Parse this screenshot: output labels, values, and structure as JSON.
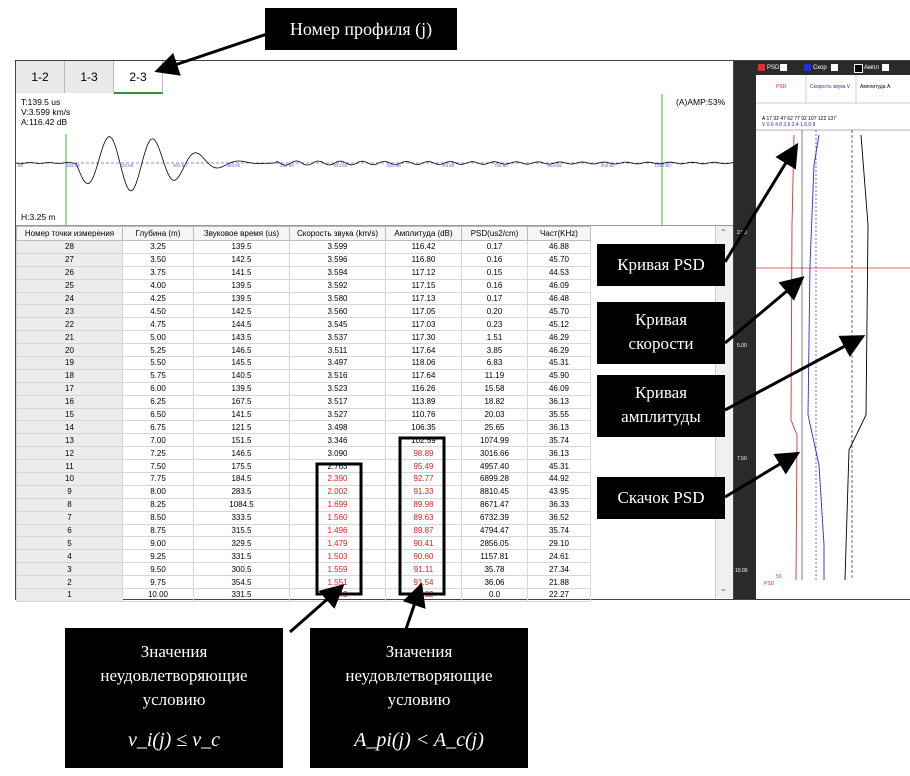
{
  "tabs": [
    "1-2",
    "1-3",
    "2-3"
  ],
  "wave": {
    "t": "T:139.5 us",
    "v": "V:3.599 km/s",
    "a": "A:116.42 dB",
    "amp": "(A)AMP:53%",
    "h": "H:3.25 m",
    "axis": [
      "80",
      "163.60",
      "223.60",
      "303.60",
      "383.60",
      "463.60",
      "543.60",
      "623.60",
      "703.60",
      "783.60",
      "863.60",
      "943.60",
      "1023.60"
    ]
  },
  "table": {
    "headers": [
      "Номер точки измерения",
      "Глубина (m)",
      "Звуковое время (us)",
      "Скорость звука (km/s)",
      "Амплитуда (dB)",
      "PSD(us2/cm)",
      "Част(KHz)"
    ],
    "rows": [
      [
        "28",
        "3.25",
        "139.5",
        "3.599",
        "116.42",
        "0.17",
        "46.88"
      ],
      [
        "27",
        "3.50",
        "142.5",
        "3.596",
        "116.80",
        "0.16",
        "45.70"
      ],
      [
        "26",
        "3.75",
        "141.5",
        "3.594",
        "117.12",
        "0.15",
        "44.53"
      ],
      [
        "25",
        "4.00",
        "139.5",
        "3.592",
        "117.15",
        "0.16",
        "46.09"
      ],
      [
        "24",
        "4.25",
        "139.5",
        "3.580",
        "117.13",
        "0.17",
        "46.48"
      ],
      [
        "23",
        "4.50",
        "142.5",
        "3.560",
        "117.05",
        "0.20",
        "45.70"
      ],
      [
        "22",
        "4.75",
        "144.5",
        "3.545",
        "117.03",
        "0.23",
        "45.12"
      ],
      [
        "21",
        "5.00",
        "143.5",
        "3.537",
        "117.30",
        "1.51",
        "46.29"
      ],
      [
        "20",
        "5.25",
        "146.5",
        "3.511",
        "117.64",
        "3.85",
        "46.29"
      ],
      [
        "19",
        "5.50",
        "145.5",
        "3.497",
        "118.06",
        "6.83",
        "45.31"
      ],
      [
        "18",
        "5.75",
        "140.5",
        "3.516",
        "117.64",
        "11.19",
        "45.90"
      ],
      [
        "17",
        "6.00",
        "139.5",
        "3.523",
        "116.26",
        "15.58",
        "46.09"
      ],
      [
        "16",
        "6.25",
        "167.5",
        "3.517",
        "113.89",
        "18.82",
        "36.13"
      ],
      [
        "15",
        "6.50",
        "141.5",
        "3.527",
        "110.76",
        "20.03",
        "35.55"
      ],
      [
        "14",
        "6.75",
        "121.5",
        "3.498",
        "106.35",
        "25.65",
        "36.13"
      ],
      [
        "13",
        "7.00",
        "151.5",
        "3.346",
        "102.59",
        "1074.99",
        "35.74"
      ],
      [
        "12",
        "7.25",
        "146.5",
        "3.090",
        "98.89",
        "3016.66",
        "36.13"
      ],
      [
        "11",
        "7.50",
        "175.5",
        "2.763",
        "95.49",
        "4957.40",
        "45.31"
      ],
      [
        "10",
        "7.75",
        "184.5",
        "2.390",
        "92.77",
        "6899.28",
        "44.92"
      ],
      [
        "9",
        "8.00",
        "283.5",
        "2.002",
        "91.33",
        "8810.45",
        "43.95"
      ],
      [
        "8",
        "8.25",
        "1084.5",
        "1.699",
        "89.98",
        "8671.47",
        "36.33"
      ],
      [
        "7",
        "8.50",
        "333.5",
        "1.560",
        "89.63",
        "6732.39",
        "36.52"
      ],
      [
        "6",
        "8.75",
        "315.5",
        "1.496",
        "89.87",
        "4794.47",
        "35.74"
      ],
      [
        "5",
        "9.00",
        "329.5",
        "1.479",
        "90.41",
        "2856.05",
        "29.10"
      ],
      [
        "4",
        "9.25",
        "331.5",
        "1.503",
        "90.60",
        "1157.81",
        "24.61"
      ],
      [
        "3",
        "9.50",
        "300.5",
        "1.559",
        "91.11",
        "35.78",
        "27.34"
      ],
      [
        "2",
        "9.75",
        "354.5",
        "1.551",
        "91.54",
        "36.06",
        "21.88"
      ],
      [
        "1",
        "10.00",
        "331.5",
        "1.543",
        "91.92",
        "0.0",
        "22.27"
      ]
    ],
    "red_velocity_from_row": 18,
    "red_amplitude_from_row": 16
  },
  "right_panel": {
    "legend": [
      "PSD",
      "Скор",
      "Ампл"
    ],
    "cols": [
      "PSD",
      "Скорость звука V",
      "Амплитуда A"
    ],
    "a_scale": "A  17  32  47  62  77  92  107  122  137",
    "v_scale": "V  0.6  4.8  3.6  2.4  1.6  0.8",
    "depths": [
      "2.50",
      "5.00",
      "7.50",
      "10.00"
    ],
    "bottom_labels": [
      "50",
      "PSD"
    ],
    "colors": {
      "psd": "#e03030",
      "velocity": "#2030e0",
      "amplitude": "#000000"
    }
  },
  "callouts": {
    "profile_number": "Номер профиля (j)",
    "psd_curve": "Кривая PSD",
    "velocity_curve": [
      "Кривая",
      "скорости"
    ],
    "amplitude_curve": [
      "Кривая",
      "амплитуды"
    ],
    "psd_jump": "Скачок PSD",
    "bad_values_1": [
      "Значения",
      "неудовлетворяющие",
      "условию"
    ],
    "bad_values_2": [
      "Значения",
      "неудовлетворяющие",
      "условию"
    ]
  },
  "formulas": {
    "f1": "v_i(j) ≤ v_c",
    "f2": "A_pi(j) < A_c(j)"
  }
}
